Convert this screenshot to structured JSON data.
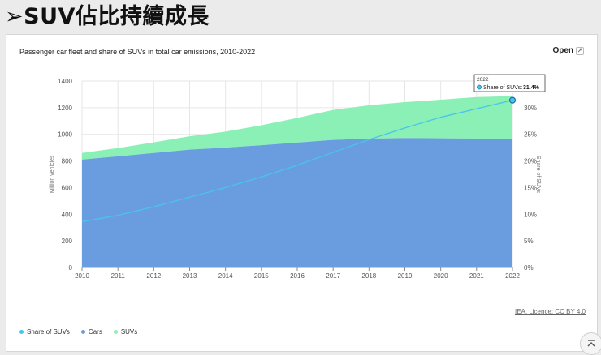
{
  "slide": {
    "title": "➢SUV佔比持續成長"
  },
  "header": {
    "open_label": "Open",
    "licence": "IEA. Licence: CC BY 4.0"
  },
  "colors": {
    "cars": "#6a9ddf",
    "suvs": "#8bf0b5",
    "share": "#48c4ee",
    "grid": "#e6e6e6"
  },
  "chart_data": {
    "type": "area",
    "title": "Passenger car fleet and share of SUVs in total car emissions, 2010-2022",
    "ylabel": "Million vehicles",
    "y2label": "Share of SUVs",
    "x": [
      "2010",
      "2011",
      "2012",
      "2013",
      "2014",
      "2015",
      "2016",
      "2017",
      "2018",
      "2019",
      "2020",
      "2021",
      "2022"
    ],
    "ylim": [
      0,
      1400
    ],
    "yticks": [
      "0",
      "200",
      "400",
      "600",
      "800",
      "1000",
      "1200",
      "1400"
    ],
    "y2lim": [
      0,
      35
    ],
    "y2ticks": [
      "0%",
      "5%",
      "10%",
      "15%",
      "20%",
      "25%",
      "30%"
    ],
    "series": [
      {
        "name": "Cars",
        "values": [
          810,
          835,
          860,
          885,
          900,
          918,
          938,
          958,
          968,
          972,
          970,
          968,
          962
        ]
      },
      {
        "name": "SUVs",
        "values": [
          50,
          62,
          80,
          100,
          120,
          150,
          185,
          225,
          250,
          270,
          290,
          312,
          325
        ]
      },
      {
        "name": "Share of SUVs",
        "axis": "right",
        "values": [
          8.6,
          9.8,
          11.4,
          13.2,
          15.0,
          17.0,
          19.2,
          21.6,
          24.0,
          26.2,
          28.2,
          29.8,
          31.4
        ]
      }
    ],
    "tooltip": {
      "year": "2022",
      "label": "Share of SUVs:",
      "value": "31.4%"
    },
    "legend": {
      "position": "bottom-left",
      "items": [
        "Share of SUVs",
        "Cars",
        "SUVs"
      ]
    },
    "grid": true
  }
}
